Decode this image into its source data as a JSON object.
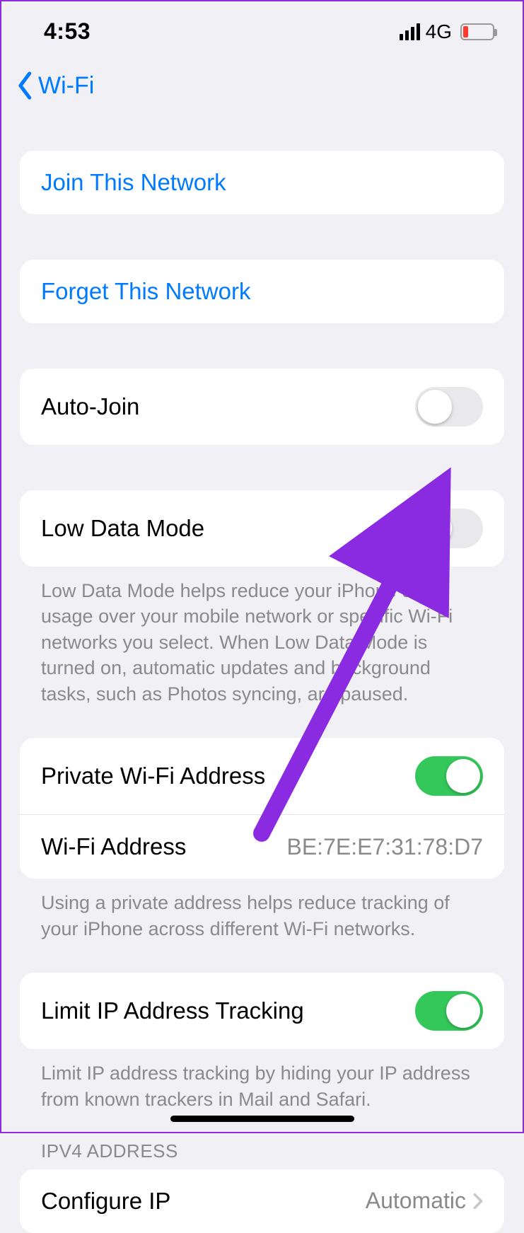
{
  "status": {
    "time": "4:53",
    "network_label": "4G"
  },
  "nav": {
    "back_label": "Wi-Fi"
  },
  "rows": {
    "join_label": "Join This Network",
    "forget_label": "Forget This Network",
    "auto_join_label": "Auto-Join",
    "auto_join_on": false,
    "low_data_label": "Low Data Mode",
    "low_data_on": false,
    "low_data_footer": "Low Data Mode helps reduce your iPhone data usage over your mobile network or specific Wi-Fi networks you select. When Low Data Mode is turned on, automatic updates and background tasks, such as Photos syncing, are paused.",
    "private_wifi_label": "Private Wi-Fi Address",
    "private_wifi_on": true,
    "wifi_address_label": "Wi-Fi Address",
    "wifi_address_value": "BE:7E:E7:31:78:D7",
    "private_footer": "Using a private address helps reduce tracking of your iPhone across different Wi-Fi networks.",
    "limit_ip_label": "Limit IP Address Tracking",
    "limit_ip_on": true,
    "limit_ip_footer": "Limit IP address tracking by hiding your IP address from known trackers in Mail and Safari.",
    "ipv4_header": "IPV4 ADDRESS",
    "configure_ip_label": "Configure IP",
    "configure_ip_value": "Automatic"
  }
}
